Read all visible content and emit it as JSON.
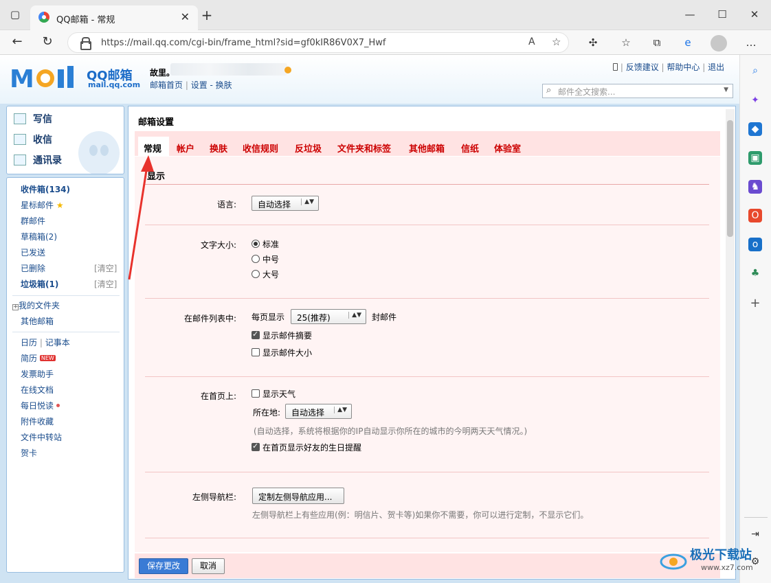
{
  "browser": {
    "tab_title": "QQ邮箱 - 常规",
    "tab_close": "✕",
    "new_tab": "+",
    "url": "https://mail.qq.com/cgi-bin/frame_html?sid=gf0kIR86V0X7_Hwf",
    "window_min": "—",
    "window_max": "☐",
    "window_close": "✕"
  },
  "header": {
    "logo_text": "QQ邮箱",
    "logo_sub": "mail.qq.com",
    "user_name": "故里。",
    "links": [
      "邮箱首页",
      "设置",
      "换肤"
    ],
    "top_links": [
      "反馈建议",
      "帮助中心",
      "退出"
    ],
    "search_placeholder": "邮件全文搜索..."
  },
  "left_nav": {
    "write": "写信",
    "inbox_btn": "收信",
    "contacts": "通讯录",
    "folders": [
      {
        "label": "收件箱(134)"
      },
      {
        "label": "星标邮件"
      },
      {
        "label": "群邮件"
      },
      {
        "label": "草稿箱(2)"
      },
      {
        "label": "已发送"
      },
      {
        "label": "已删除"
      },
      {
        "label": "垃圾箱(1)"
      }
    ],
    "clear": "[清空]",
    "my_folders": "我的文件夹",
    "other_mail": "其他邮箱",
    "calendar": "日历",
    "notes": "记事本",
    "apps": [
      "简历",
      "发票助手",
      "在线文档",
      "每日悦读",
      "附件收藏",
      "文件中转站",
      "贺卡"
    ],
    "new_badge": "NEW"
  },
  "main": {
    "title": "邮箱设置",
    "tabs": [
      "常规",
      "帐户",
      "换肤",
      "收信规则",
      "反垃圾",
      "文件夹和标签",
      "其他邮箱",
      "信纸",
      "体验室"
    ],
    "section": "显示",
    "language_label": "语言:",
    "language_value": "自动选择",
    "fontsize_label": "文字大小:",
    "fontsize_options": [
      "标准",
      "中号",
      "大号"
    ],
    "list_label": "在邮件列表中:",
    "per_page": "每页显示",
    "per_page_value": "25(推荐)",
    "per_page_unit": "封邮件",
    "show_summary": "显示邮件摘要",
    "show_size": "显示邮件大小",
    "home_label": "在首页上:",
    "show_weather": "显示天气",
    "location_label": "所在地:",
    "location_value": "自动选择",
    "weather_hint": "(自动选择，系统将根据你的IP自动显示你所在的城市的今明两天天气情况。)",
    "birthday": "在首页显示好友的生日提醒",
    "leftnav_label": "左侧导航栏:",
    "customize_btn": "定制左侧导航应用...",
    "leftnav_hint": "左侧导航栏上有些应用(例：明信片、贺卡等)如果你不需要，你可以进行定制，不显示它们。",
    "save": "保存更改",
    "cancel": "取消"
  },
  "watermark": {
    "text": "极光下载站",
    "url": "www.xz7.com"
  }
}
